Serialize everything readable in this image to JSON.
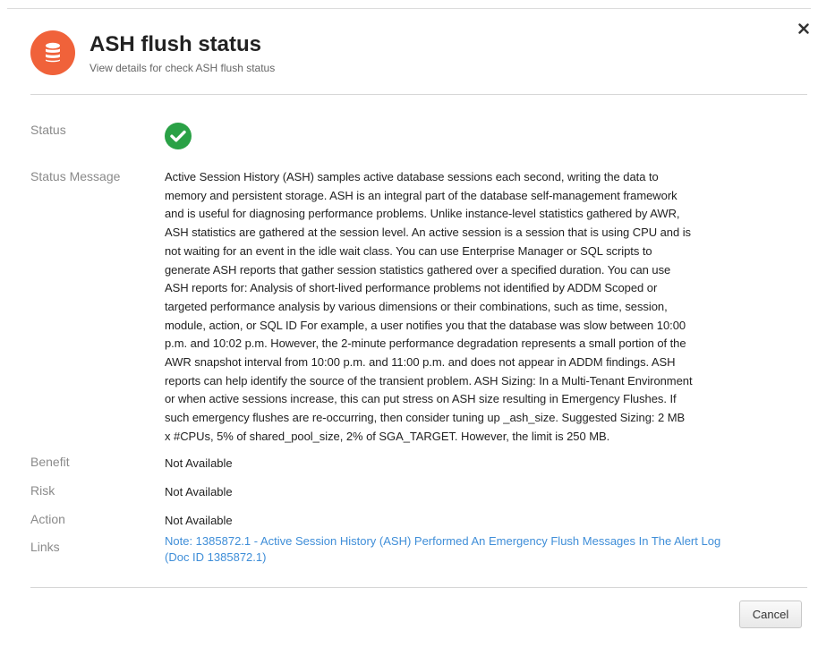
{
  "dialog": {
    "title": "ASH flush status",
    "subtitle": "View details for check ASH flush status",
    "header_icon": "database-icon",
    "close_icon": "close-icon",
    "accent_color": "#f0623a"
  },
  "fields": {
    "status": {
      "label": "Status",
      "icon": "check-circle-icon",
      "color": "#2aa146"
    },
    "status_message": {
      "label": "Status Message",
      "lines": [
        "Active Session History (ASH) samples active database sessions each second, writing the data to",
        "memory and persistent storage. ASH is an integral part of the database self-management framework",
        "and is useful for diagnosing performance problems. Unlike instance-level statistics gathered by AWR,",
        "ASH statistics are gathered at the session level. An active session is a session that is using CPU and is",
        "not waiting for an event in the idle wait class. You can use Enterprise Manager or SQL scripts to",
        "generate ASH reports that gather session statistics gathered over a specified duration. You can use",
        "ASH reports for: Analysis of short-lived performance problems not identified by ADDM Scoped or",
        "targeted performance analysis by various dimensions or their combinations, such as time, session,",
        "module, action, or SQL ID For example, a user notifies you that the database was slow between 10:00",
        "p.m. and 10:02 p.m. However, the 2-minute performance degradation represents a small portion of the",
        "AWR snapshot interval from 10:00 p.m. and 11:00 p.m. and does not appear in ADDM findings. ASH",
        "reports can help identify the source of the transient problem. ASH Sizing: In a Multi-Tenant Environment",
        "or when active sessions increase, this can put stress on ASH size resulting in Emergency Flushes. If",
        "such emergency flushes are re-occurring, then consider tuning up _ash_size. Suggested Sizing: 2 MB",
        "x #CPUs, 5% of shared_pool_size, 2% of SGA_TARGET. However, the limit is 250 MB."
      ]
    },
    "benefit": {
      "label": "Benefit",
      "value": "Not Available"
    },
    "risk": {
      "label": "Risk",
      "value": "Not Available"
    },
    "action": {
      "label": "Action",
      "value": "Not Available"
    },
    "links": {
      "label": "Links",
      "line1": "Note: 1385872.1 - Active Session History (ASH) Performed An Emergency Flush Messages In The Alert Log",
      "line2": "(Doc ID 1385872.1)",
      "color": "#3f8ed8"
    }
  },
  "footer": {
    "cancel_label": "Cancel"
  }
}
